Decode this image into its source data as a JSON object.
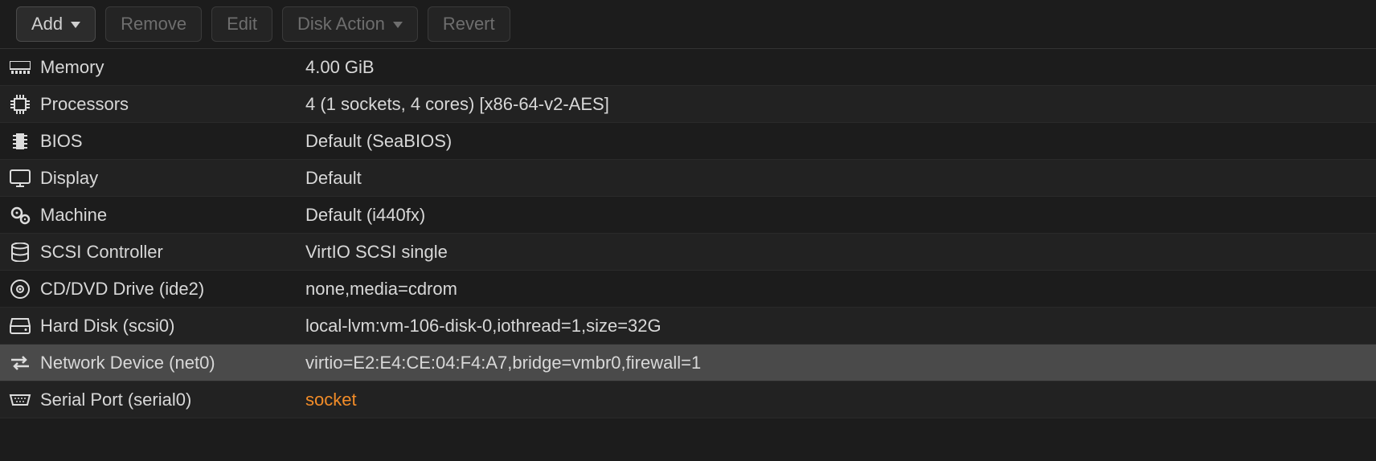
{
  "toolbar": {
    "add": "Add",
    "remove": "Remove",
    "edit": "Edit",
    "diskAction": "Disk Action",
    "revert": "Revert"
  },
  "rows": [
    {
      "icon": "memory",
      "label": "Memory",
      "value": "4.00 GiB"
    },
    {
      "icon": "cpu",
      "label": "Processors",
      "value": "4 (1 sockets, 4 cores) [x86-64-v2-AES]"
    },
    {
      "icon": "bios",
      "label": "BIOS",
      "value": "Default (SeaBIOS)"
    },
    {
      "icon": "display",
      "label": "Display",
      "value": "Default"
    },
    {
      "icon": "machine",
      "label": "Machine",
      "value": "Default (i440fx)"
    },
    {
      "icon": "scsi",
      "label": "SCSI Controller",
      "value": "VirtIO SCSI single"
    },
    {
      "icon": "cd",
      "label": "CD/DVD Drive (ide2)",
      "value": "none,media=cdrom"
    },
    {
      "icon": "hdd",
      "label": "Hard Disk (scsi0)",
      "value": "local-lvm:vm-106-disk-0,iothread=1,size=32G"
    },
    {
      "icon": "net",
      "label": "Network Device (net0)",
      "value": "virtio=E2:E4:CE:04:F4:A7,bridge=vmbr0,firewall=1"
    },
    {
      "icon": "serial",
      "label": "Serial Port (serial0)",
      "value": "socket"
    }
  ]
}
